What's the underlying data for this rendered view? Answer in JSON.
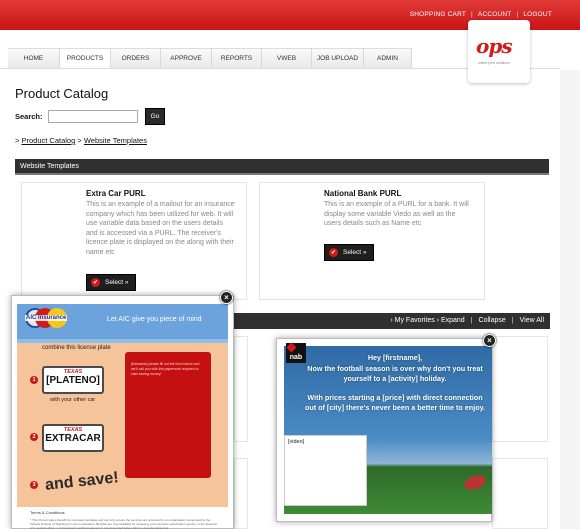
{
  "header": {
    "links": [
      "SHOPPING CART",
      "ACCOUNT",
      "LOGOUT"
    ],
    "logo_text": "ops",
    "logo_tagline": "online print solutions"
  },
  "nav": {
    "tabs": [
      "HOME",
      "PRODUCTS",
      "ORDERS",
      "APPROVE",
      "REPORTS",
      "VWEB",
      "JOB UPLOAD",
      "ADMIN"
    ],
    "active": "PRODUCTS"
  },
  "page": {
    "title": "Product Catalog",
    "search_label": "Search:",
    "search_value": "",
    "go_label": "Go",
    "breadcrumb": {
      "prefix": ">",
      "root": "Product Catalog",
      "sep": ">",
      "current": "Website Templates"
    },
    "section_title": "Website Templates"
  },
  "products": [
    {
      "title": "Extra Car PURL",
      "description": "This is an example of a mailout for an insurance company which has been utilized for web. It will use variable data based on the users details and is accessed via a PURL. The receiver's licence plate is displayed on the along with their name etc",
      "button": "Select »"
    },
    {
      "title": "National Bank PURL",
      "description": "This is an example of a PURL for a bank. It will display some variable Viedo as well as the users details such as Name etc",
      "button": "Select »"
    }
  ],
  "favorites_bar": {
    "links": [
      "› My Favorites",
      "› Expand",
      "Collapse",
      "View All"
    ]
  },
  "popup_aic": {
    "logo_text": "AIC Insurance",
    "slogan": "Let AIC give you piece of mind",
    "intro": "combine this license plate",
    "plate1_state": "TEXAS",
    "plate1_number": "[PLATENO]",
    "plate1_caption": "with your other car",
    "plate2_state": "TEXAS",
    "plate2_number": "EXTRACAR",
    "save_text": "and save!",
    "side_text": "[firstname] please fill out the form below and we'll call you with the paperwork required to start saving money!",
    "terms_title": "Terms & Conditions",
    "terms_text": "* This Pursuit was a benefit for consistent template and can only ensure the services are protected by an organisation recognised by the Victoria Institute of Teaching for use in education. Benefits are only available for arranging your complete subscription service, in the absence of a medical officer, a professional medical treatment is recommended before fitting a complex Extra Car."
  },
  "popup_nab": {
    "logo": "nab",
    "message": "Hey [firstname], Now the football season is over why don't you treat yourself to a [activity] holiday. With prices starting a [price] with direct connection out of [city] there's never been a better time to enjoy.",
    "line1": "Hey [firstname],",
    "line2": "Now the football season is over why don't you treat yourself to a [activity] holiday.",
    "line3": "With prices starting a [price] with direct connection out of [city] there's never been a better time to enjoy.",
    "video_label": "[video]"
  },
  "colors": {
    "brand_red": "#c81414",
    "dark_bar": "#303030"
  }
}
